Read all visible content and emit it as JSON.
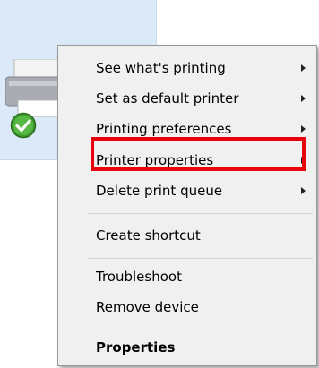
{
  "menu": {
    "items": [
      {
        "label": "See what's printing",
        "submenu": true
      },
      {
        "label": "Set as default printer",
        "submenu": true
      },
      {
        "label": "Printing preferences",
        "submenu": true
      },
      {
        "label": "Printer properties",
        "submenu": true
      },
      {
        "label": "Delete print queue",
        "submenu": true
      },
      {
        "label": "Create shortcut",
        "submenu": false
      },
      {
        "label": "Troubleshoot",
        "submenu": false
      },
      {
        "label": "Remove device",
        "submenu": false
      },
      {
        "label": "Properties",
        "submenu": false,
        "bold": true
      }
    ]
  },
  "icons": {
    "device": "printer-icon",
    "status": "default-printer-check-icon"
  },
  "colors": {
    "highlight_border": "#e8000e",
    "tile_background": "#dce9f8",
    "menu_background": "#f0f0f0"
  }
}
